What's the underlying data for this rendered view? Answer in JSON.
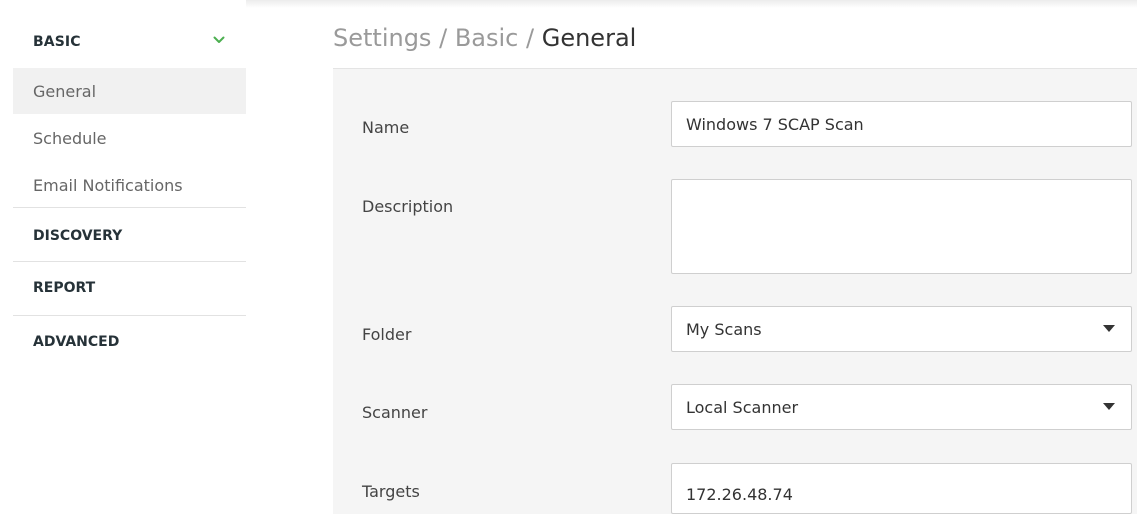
{
  "sidebar": {
    "sections": [
      {
        "label": "BASIC",
        "expanded": true,
        "items": [
          {
            "label": "General",
            "active": true
          },
          {
            "label": "Schedule",
            "active": false
          },
          {
            "label": "Email Notifications",
            "active": false
          }
        ]
      },
      {
        "label": "DISCOVERY",
        "expanded": false
      },
      {
        "label": "REPORT",
        "expanded": false
      },
      {
        "label": "ADVANCED",
        "expanded": false
      }
    ]
  },
  "breadcrumb": {
    "parts": [
      "Settings",
      "Basic",
      "General"
    ],
    "separator": "/"
  },
  "form": {
    "name": {
      "label": "Name",
      "value": "Windows 7 SCAP Scan"
    },
    "description": {
      "label": "Description",
      "value": ""
    },
    "folder": {
      "label": "Folder",
      "value": "My Scans"
    },
    "scanner": {
      "label": "Scanner",
      "value": "Local Scanner"
    },
    "targets": {
      "label": "Targets",
      "value": "172.26.48.74"
    }
  },
  "colors": {
    "accent_chevron": "#4caf50",
    "active_item_bg": "#f1f1f1",
    "form_bg": "#f5f5f5"
  },
  "icons": {
    "basic_toggle": "chevron-down-icon",
    "select_caret": "caret-down-icon"
  }
}
